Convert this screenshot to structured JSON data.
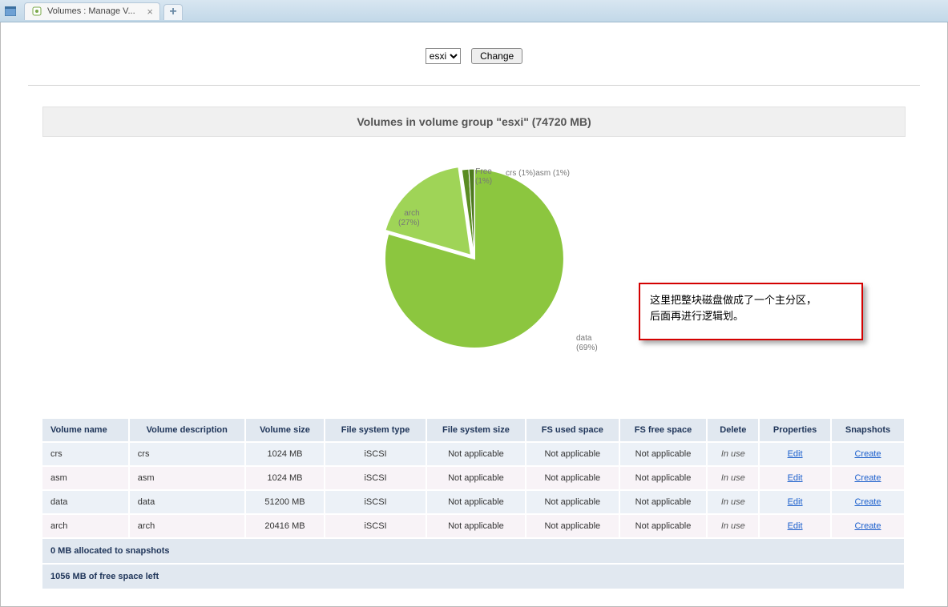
{
  "browser": {
    "tab_title": "Volumes : Manage V...",
    "tab_close_glyph": "×",
    "new_tab_glyph": "+"
  },
  "top_controls": {
    "select_options": [
      "esxi"
    ],
    "selected": "esxi",
    "change_button": "Change"
  },
  "section_title": "Volumes in volume group \"esxi\" (74720 MB)",
  "chart_data": {
    "type": "pie",
    "title": "",
    "total_label_unit": "MB",
    "slices": [
      {
        "name": "data",
        "percent": 69,
        "color": "#8cc63f"
      },
      {
        "name": "arch",
        "percent": 27,
        "color": "#8cc63f"
      },
      {
        "name": "Free",
        "percent": 1,
        "color": "#5a8c22"
      },
      {
        "name": "crs",
        "percent": 1,
        "color": "#5a8c22"
      },
      {
        "name": "asm",
        "percent": 1,
        "color": "#5a8c22"
      }
    ],
    "labels": {
      "data": "data\n(69%)",
      "arch": "arch\n(27%)",
      "free": "Free\n(1%)",
      "crsasm": "crs (1%)asm (1%)"
    }
  },
  "annotation": {
    "line1": "这里把整块磁盘做成了一个主分区，",
    "line2": "后面再进行逻辑划。"
  },
  "table": {
    "headers": [
      "Volume name",
      "Volume description",
      "Volume size",
      "File system type",
      "File system size",
      "FS used space",
      "FS free space",
      "Delete",
      "Properties",
      "Snapshots"
    ],
    "rows": [
      {
        "name": "crs",
        "desc": "crs",
        "size": "1024 MB",
        "fstype": "iSCSI",
        "fssize": "Not applicable",
        "fsused": "Not applicable",
        "fsfree": "Not applicable",
        "delete": "In use",
        "prop": "Edit",
        "snap": "Create"
      },
      {
        "name": "asm",
        "desc": "asm",
        "size": "1024 MB",
        "fstype": "iSCSI",
        "fssize": "Not applicable",
        "fsused": "Not applicable",
        "fsfree": "Not applicable",
        "delete": "In use",
        "prop": "Edit",
        "snap": "Create"
      },
      {
        "name": "data",
        "desc": "data",
        "size": "51200 MB",
        "fstype": "iSCSI",
        "fssize": "Not applicable",
        "fsused": "Not applicable",
        "fsfree": "Not applicable",
        "delete": "In use",
        "prop": "Edit",
        "snap": "Create"
      },
      {
        "name": "arch",
        "desc": "arch",
        "size": "20416 MB",
        "fstype": "iSCSI",
        "fssize": "Not applicable",
        "fsused": "Not applicable",
        "fsfree": "Not applicable",
        "delete": "In use",
        "prop": "Edit",
        "snap": "Create"
      }
    ],
    "footer1": "0 MB allocated to snapshots",
    "footer2": "1056 MB of free space left"
  }
}
